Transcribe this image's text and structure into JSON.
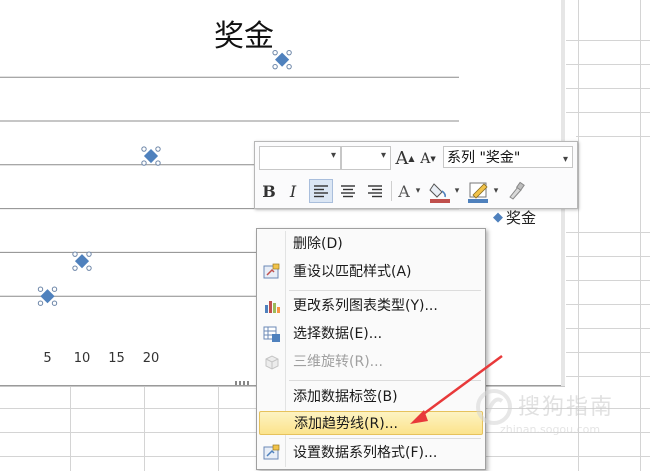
{
  "chart": {
    "title": "奖金",
    "legend_label": "奖金",
    "series_color": "#4f81bd"
  },
  "chart_data": {
    "type": "scatter",
    "title": "奖金",
    "x_ticks": [
      "5",
      "10",
      "15",
      "20"
    ],
    "series": [
      {
        "name": "奖金",
        "x": [
          5,
          10,
          20,
          39
        ],
        "y": [
          1,
          1.8,
          4.2,
          6.4
        ]
      }
    ]
  },
  "toolbar": {
    "font_value": "",
    "size_value": "",
    "grow_font": "A",
    "shrink_font": "A",
    "series_label": "系列 \"奖金\"",
    "bold": "B",
    "italic": "I",
    "font_color_label": "A",
    "fill_color": "#c0504d",
    "line_color": "#4f81bd"
  },
  "context_menu": {
    "items": [
      {
        "label": "删除(D)",
        "disabled": false
      },
      {
        "label": "重设以匹配样式(A)",
        "disabled": false
      },
      {
        "label": "更改系列图表类型(Y)...",
        "disabled": false
      },
      {
        "label": "选择数据(E)...",
        "disabled": false
      },
      {
        "label": "三维旋转(R)...",
        "disabled": true
      },
      {
        "label": "添加数据标签(B)",
        "disabled": false
      },
      {
        "label": "添加趋势线(R)...",
        "disabled": false,
        "highlighted": true
      },
      {
        "label": "设置数据系列格式(F)...",
        "disabled": false
      }
    ]
  },
  "watermark": {
    "text": "搜狗指南",
    "url": "zhinan.sogou.com"
  },
  "annotation": {
    "arrow_color": "#e8393a"
  }
}
